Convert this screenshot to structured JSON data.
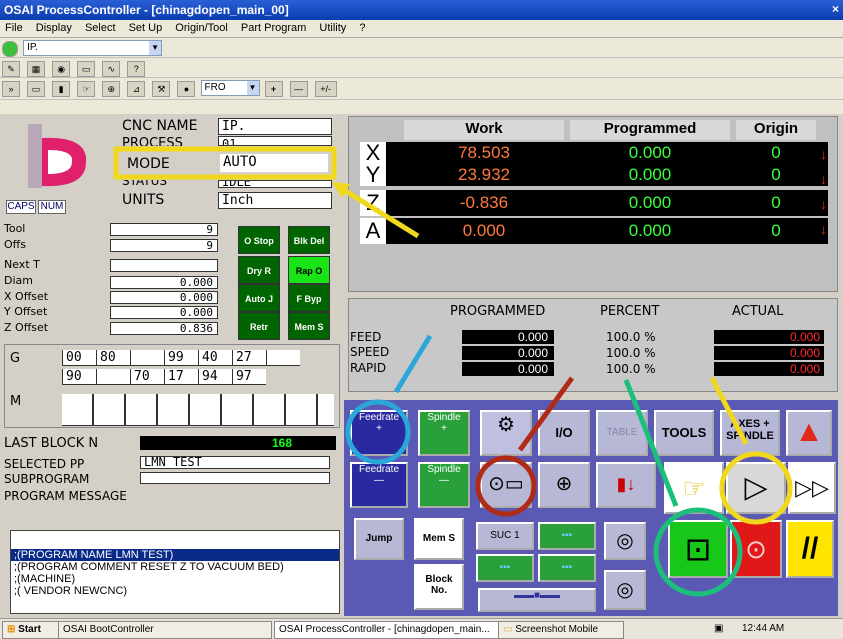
{
  "window": {
    "title": "OSAI ProcessController - [chinagdopen_main_00]",
    "close": "×"
  },
  "menu": [
    "File",
    "Display",
    "Select",
    "Set Up",
    "Origin/Tool",
    "Part Program",
    "Utility",
    "?"
  ],
  "toolbar": {
    "process_combo": "IP.",
    "fro_combo": "FRO",
    "plus": "+",
    "minus": "—",
    "plusminus": "+/-"
  },
  "status": {
    "cnc_name_label": "CNC NAME",
    "cnc_name": "IP.",
    "process_label": "PROCESS",
    "process": "01",
    "mode_label": "MODE",
    "mode": "AUTO",
    "status_label": "STATUS",
    "status": "IDLE",
    "units_label": "UNITS",
    "units": "Inch",
    "caps": "CAPS",
    "num": "NUM"
  },
  "tool": {
    "rows": [
      {
        "label": "Tool",
        "value": "9"
      },
      {
        "label": "Offs",
        "value": "9"
      },
      {
        "label": "Next T",
        "value": ""
      },
      {
        "label": "Diam",
        "value": "0.000"
      },
      {
        "label": "X Offset",
        "value": "0.000"
      },
      {
        "label": "Y Offset",
        "value": "0.000"
      },
      {
        "label": "Z Offset",
        "value": "0.836"
      }
    ]
  },
  "mode_buttons": [
    "O Stop",
    "Blk Del",
    "Dry R",
    "Rap O",
    "Auto J",
    "F Byp",
    "Retr",
    "Mem S"
  ],
  "gcodes": {
    "g_label": "G",
    "row1": [
      "00",
      "80",
      "",
      "99",
      "40",
      "27",
      ""
    ],
    "row2": [
      "90",
      "",
      "70",
      "17",
      "94",
      "97",
      ""
    ],
    "m_label": "M"
  },
  "last_block": {
    "label": "LAST BLOCK N",
    "value": "168"
  },
  "program": {
    "selected_label": "SELECTED PP",
    "selected": "LMN TEST",
    "subprogram_label": "SUBPROGRAM",
    "subprogram": "",
    "message_label": "PROGRAM MESSAGE",
    "lines": [
      ";(PROGRAM NAME LMN TEST)",
      ";(PROGRAM COMMENT RESET Z TO VACUUM BED)",
      ";(MACHINE)",
      ";(  VENDOR NEWCNC)"
    ]
  },
  "axes": {
    "headers": {
      "work": "Work",
      "programmed": "Programmed",
      "origin": "Origin"
    },
    "rows": [
      {
        "axis": "X",
        "work": "78.503",
        "programmed": "0.000",
        "origin": "0"
      },
      {
        "axis": "Y",
        "work": "23.932",
        "programmed": "0.000",
        "origin": "0"
      },
      {
        "axis": "Z",
        "work": "-0.836",
        "programmed": "0.000",
        "origin": "0"
      },
      {
        "axis": "A",
        "work": "0.000",
        "programmed": "0.000",
        "origin": "0"
      }
    ]
  },
  "feed": {
    "headers": {
      "programmed": "PROGRAMMED",
      "percent": "PERCENT",
      "actual": "ACTUAL"
    },
    "rows": [
      {
        "label": "FEED",
        "programmed": "0.000",
        "percent": "100.0 %",
        "actual": "0.000"
      },
      {
        "label": "SPEED",
        "programmed": "0.000",
        "percent": "100.0 %",
        "actual": "0.000"
      },
      {
        "label": "RAPID",
        "programmed": "0.000",
        "percent": "100.0 %",
        "actual": "0.000"
      }
    ]
  },
  "softkeys": {
    "feedrate": "Feedrate",
    "spindle": "Spindle",
    "plus": "+",
    "minus": "—",
    "io": "I/O",
    "table": "TABLE",
    "tools": "TOOLS",
    "axes_spindle": "AXES + SPINDLE",
    "jump": "Jump",
    "mem_s": "Mem S",
    "suc1": "SUC 1",
    "block_no": "Block No.",
    "find_zero": "Find Zero"
  },
  "colors": {
    "accent_yellow": "#f2d81c",
    "accent_blue": "#2aa7d8",
    "accent_red": "#b02a18",
    "accent_green": "#1bbf7a"
  },
  "taskbar": {
    "start": "Start",
    "tasks": [
      "OSAI BootController",
      "OSAI ProcessController - [chinagdopen_main...",
      "Screenshot Mobile"
    ],
    "clock": "12:44 AM"
  }
}
